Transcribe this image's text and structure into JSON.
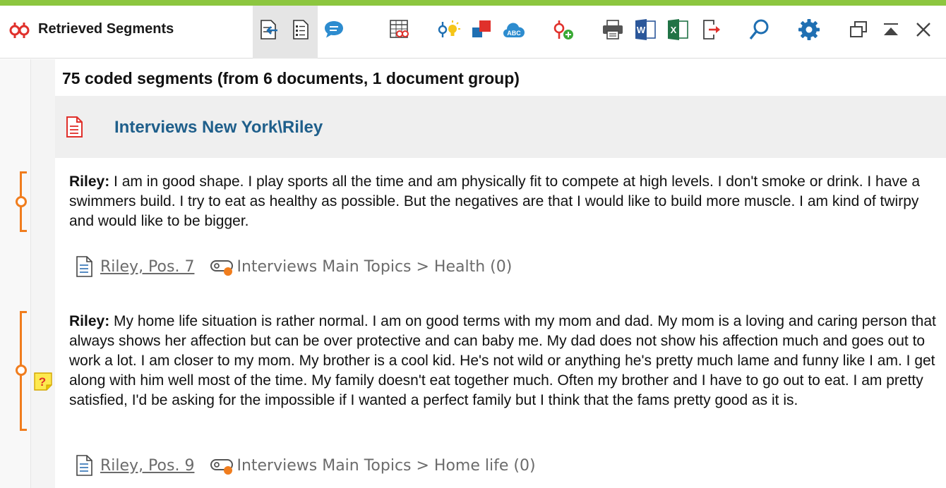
{
  "window": {
    "title": "Retrieved Segments",
    "accent_color": "#8cc63f"
  },
  "toolbar": {
    "buttons": [
      "export-segments-icon",
      "list-view-icon",
      "comment-icon",
      "code-matrix-icon",
      "smart-coding-icon",
      "color-codes-icon",
      "word-cloud-icon",
      "add-code-icon",
      "print-icon",
      "word-export-icon",
      "excel-export-icon",
      "export-icon",
      "search-icon",
      "settings-icon",
      "undock-window-icon",
      "collapse-icon",
      "close-icon"
    ]
  },
  "summary": "75 coded segments (from 6 documents, 1 document group)",
  "document": {
    "title": "Interviews New York\\Riley",
    "icon": "pdf-document-icon",
    "icon_color": "#e0302b"
  },
  "segments": [
    {
      "speaker": "Riley:",
      "text": " I am in good shape. I play sports all the time and am physically fit to compete at high levels. I don't smoke or drink. I have a swimmers build. I try to eat as healthy as possible. But the negatives are that I would like to build more muscle. I am kind of twirpy and would like to be bigger.",
      "source": "Riley, Pos. 7",
      "code": "Interviews Main Topics > Health (0)",
      "code_color": "#f07d1e",
      "has_memo": false
    },
    {
      "speaker": "Riley:",
      "text": " My home life situation is rather normal. I am on good terms with my mom and dad. My mom is a loving and caring person that always shows her affection but can be over protective and can baby me. My dad does not show his affection much and goes out to work a lot. I am closer to my mom. My brother is a cool kid. He's not wild or anything he's pretty much lame and funny like I am. I get along with him well most of the time. My family doesn't eat together much. Often my brother and I have to go out to eat. I am pretty satisfied, I'd be asking for the impossible if I wanted a perfect family but I think that the fams pretty good as it is.",
      "source": "Riley, Pos. 9",
      "code": "Interviews Main Topics > Home life (0)",
      "code_color": "#f07d1e",
      "has_memo": true
    }
  ]
}
